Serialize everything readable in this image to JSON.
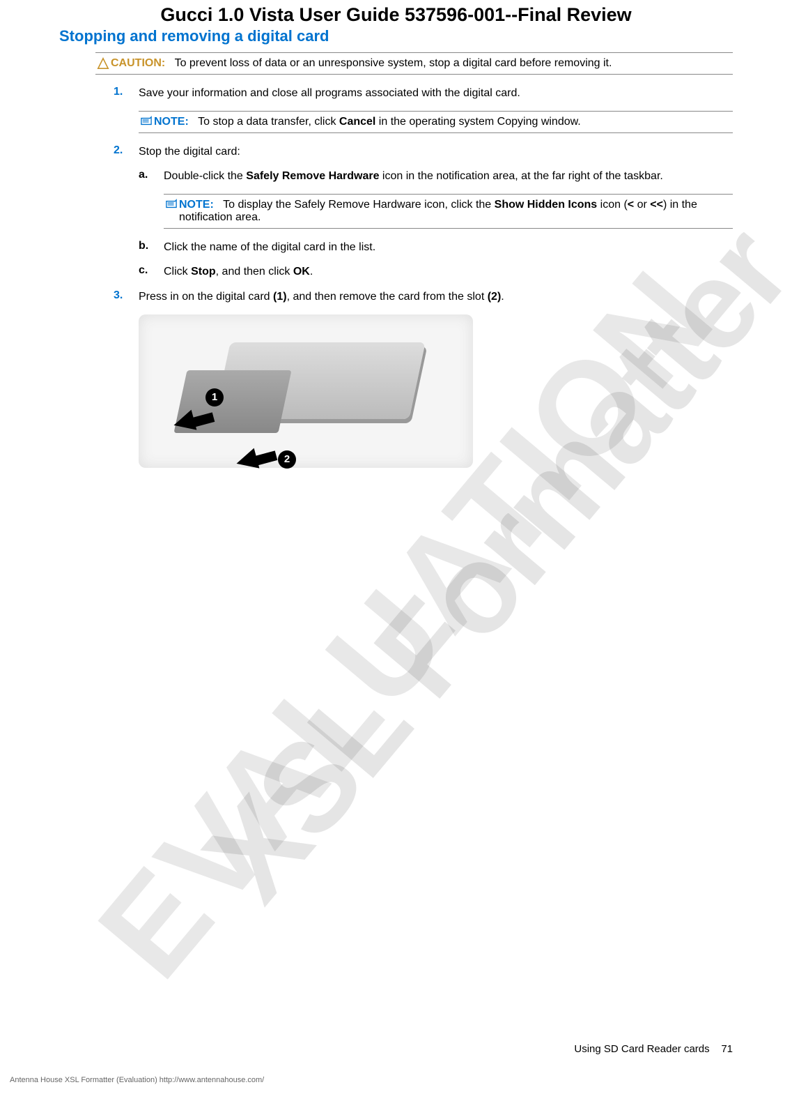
{
  "doc_title": "Gucci 1.0 Vista User Guide 537596-001--Final Review",
  "section_title": "Stopping and removing a digital card",
  "caution": {
    "label": "CAUTION:",
    "text": "To prevent loss of data or an unresponsive system, stop a digital card before removing it."
  },
  "steps": {
    "s1": {
      "num": "1.",
      "text": "Save your information and close all programs associated with the digital card."
    },
    "note1": {
      "label": "NOTE:",
      "prefix": "To stop a data transfer, click ",
      "bold": "Cancel",
      "suffix": " in the operating system Copying window."
    },
    "s2": {
      "num": "2.",
      "text": "Stop the digital card:"
    },
    "sa": {
      "label": "a.",
      "prefix": "Double-click the ",
      "bold": "Safely Remove Hardware",
      "suffix": " icon in the notification area, at the far right of the taskbar."
    },
    "note2": {
      "label": "NOTE:",
      "prefix": "To display the Safely Remove Hardware icon, click the ",
      "bold1": "Show Hidden Icons",
      "mid": " icon (",
      "bold2": "<",
      "mid2": " or ",
      "bold3": "<<",
      "suffix": ") in the notification area."
    },
    "sb": {
      "label": "b.",
      "text": "Click the name of the digital card in the list."
    },
    "sc": {
      "label": "c.",
      "prefix": "Click ",
      "bold1": "Stop",
      "mid": ", and then click ",
      "bold2": "OK",
      "suffix": "."
    },
    "s3": {
      "num": "3.",
      "prefix": "Press in on the digital card ",
      "bold1": "(1)",
      "mid": ", and then remove the card from the slot ",
      "bold2": "(2)",
      "suffix": "."
    }
  },
  "callouts": {
    "c1": "1",
    "c2": "2"
  },
  "footer": {
    "section": "Using SD Card Reader cards",
    "page": "71",
    "eval": "Antenna House XSL Formatter (Evaluation)  http://www.antennahouse.com/"
  },
  "watermarks": {
    "w1": "XSL Formatter",
    "w2": "EVALUATION"
  }
}
